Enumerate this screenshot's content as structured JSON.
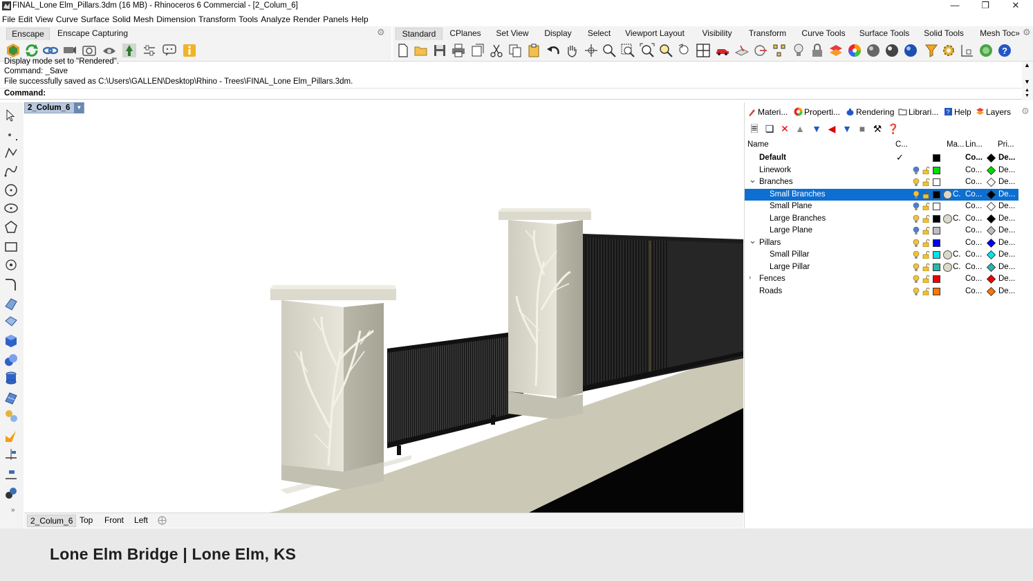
{
  "window": {
    "title": "FINAL_Lone Elm_Pillars.3dm (16 MB) - Rhinoceros 6 Commercial - [2_Colum_6]"
  },
  "menu": [
    "File",
    "Edit",
    "View",
    "Curve",
    "Surface",
    "Solid",
    "Mesh",
    "Dimension",
    "Transform",
    "Tools",
    "Analyze",
    "Render",
    "Panels",
    "Help"
  ],
  "left_tabs": [
    "Enscape",
    "Enscape Capturing"
  ],
  "right_tabs": [
    "Standard",
    "CPlanes",
    "Set View",
    "Display",
    "Select",
    "Viewport Layout",
    "Visibility",
    "Transform",
    "Curve Tools",
    "Surface Tools",
    "Solid Tools",
    "Mesh Toc»"
  ],
  "command": {
    "line1": "Display mode set to \"Rendered\".",
    "line2": "Command: _Save",
    "line3": "File successfully saved as C:\\Users\\GALLEN\\Desktop\\Rhino - Trees\\FINAL_Lone Elm_Pillars.3dm.",
    "prompt": "Command:"
  },
  "viewport": {
    "active": "2_Colum_6"
  },
  "viewport_tabs": [
    "2_Colum_6",
    "Top",
    "Front",
    "Left"
  ],
  "panel_tabs": [
    "Materi...",
    "Properti...",
    "Rendering",
    "Librari...",
    "Help",
    "Layers"
  ],
  "layers_header": {
    "name": "Name",
    "current": "C...",
    "material": "Ma...",
    "linetype": "Lin...",
    "print": "Pri..."
  },
  "layers": [
    {
      "name": "Default",
      "level": 0,
      "bold": true,
      "current": true,
      "color": "#000000",
      "material": "",
      "linetype": "Co...",
      "print": "De...",
      "print_color": "#000000",
      "expander": ""
    },
    {
      "name": "Linework",
      "level": 0,
      "color": "#00dd00",
      "material": "",
      "linetype": "Co...",
      "print": "De...",
      "print_color": "#00dd00",
      "expander": ""
    },
    {
      "name": "Branches",
      "level": 0,
      "color": "#ffffff",
      "material": "",
      "linetype": "Co...",
      "print": "De...",
      "print_color": "#ffffff",
      "expander": "v"
    },
    {
      "name": "Small Branches",
      "level": 1,
      "selected": true,
      "color": "#000000",
      "material": "C.",
      "mat_color": "#dcd8c8",
      "linetype": "Co...",
      "print": "De...",
      "print_color": "#000000",
      "expander": ""
    },
    {
      "name": "Small Plane",
      "level": 1,
      "color": "#ffffff",
      "material": "",
      "linetype": "Co...",
      "print": "De...",
      "print_color": "#ffffff",
      "expander": ""
    },
    {
      "name": "Large Branches",
      "level": 1,
      "color": "#000000",
      "material": "C.",
      "mat_color": "#dcd8c8",
      "linetype": "Co...",
      "print": "De...",
      "print_color": "#000000",
      "expander": ""
    },
    {
      "name": "Large Plane",
      "level": 1,
      "color": "#bdbdbd",
      "material": "",
      "linetype": "Co...",
      "print": "De...",
      "print_color": "#bdbdbd",
      "expander": ""
    },
    {
      "name": "Pillars",
      "level": 0,
      "color": "#0000ee",
      "material": "",
      "linetype": "Co...",
      "print": "De...",
      "print_color": "#0000ee",
      "expander": "v"
    },
    {
      "name": "Small Pillar",
      "level": 1,
      "color": "#00e5e5",
      "material": "C.",
      "mat_color": "#dcd8c8",
      "linetype": "Co...",
      "print": "De...",
      "print_color": "#00e5e5",
      "expander": ""
    },
    {
      "name": "Large Pillar",
      "level": 1,
      "color": "#2ab8a8",
      "material": "C.",
      "mat_color": "#dcd8c8",
      "linetype": "Co...",
      "print": "De...",
      "print_color": "#2ab8a8",
      "expander": ""
    },
    {
      "name": "Fences",
      "level": 0,
      "color": "#ee0000",
      "material": "",
      "linetype": "Co...",
      "print": "De...",
      "print_color": "#ee0000",
      "expander": ">"
    },
    {
      "name": "Roads",
      "level": 0,
      "color": "#ff7700",
      "material": "",
      "linetype": "Co...",
      "print": "De...",
      "print_color": "#ff7700",
      "expander": ""
    }
  ],
  "footer": {
    "caption": "Lone Elm Bridge | Lone Elm, KS"
  }
}
